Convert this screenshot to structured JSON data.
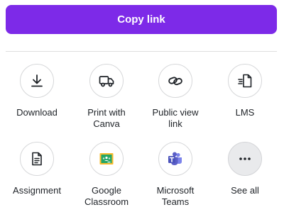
{
  "copy_link": {
    "label": "Copy link"
  },
  "share_options": [
    {
      "id": "download",
      "label": "Download",
      "icon": "download-icon"
    },
    {
      "id": "print-with-canva",
      "label": "Print with\nCanva",
      "icon": "truck-icon"
    },
    {
      "id": "public-view-link",
      "label": "Public view\nlink",
      "icon": "link-icon"
    },
    {
      "id": "lms",
      "label": "LMS",
      "icon": "lms-document-icon"
    },
    {
      "id": "assignment",
      "label": "Assignment",
      "icon": "assignment-document-icon"
    },
    {
      "id": "google-classroom",
      "label": "Google\nClassroom",
      "icon": "google-classroom-icon"
    },
    {
      "id": "microsoft-teams",
      "label": "Microsoft\nTeams",
      "icon": "microsoft-teams-icon"
    },
    {
      "id": "see-all",
      "label": "See all",
      "icon": "more-dots-icon"
    }
  ],
  "colors": {
    "accent": "#7d2ae8",
    "google_classroom_green": "#25a667",
    "google_classroom_yellow": "#f9bb2d",
    "teams_purple": "#5b5fc7"
  }
}
